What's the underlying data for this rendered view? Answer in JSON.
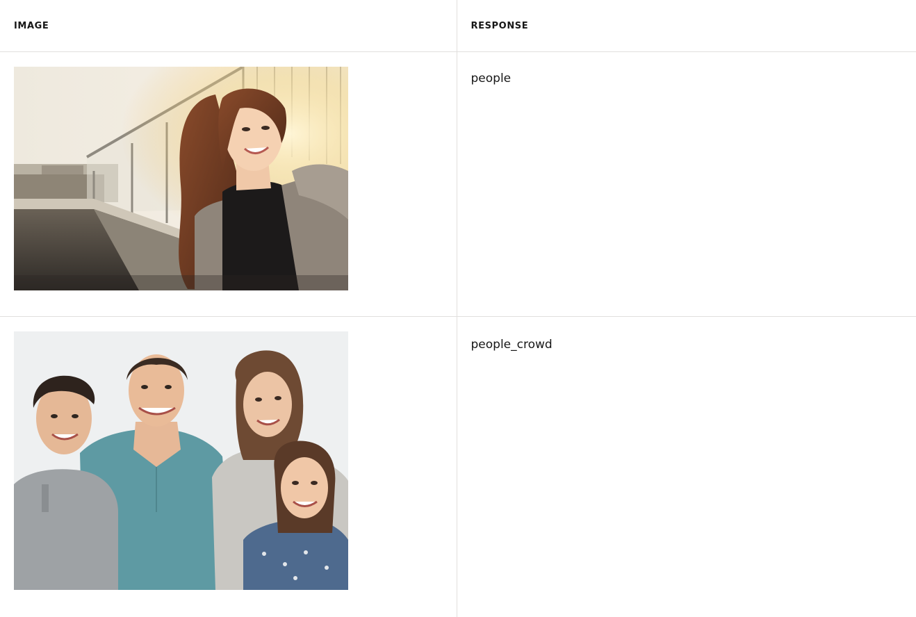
{
  "table": {
    "headers": {
      "image": "IMAGE",
      "response": "RESPONSE"
    },
    "rows": [
      {
        "image": {
          "icon": "photo-woman-on-rooftop-icon"
        },
        "response": "people"
      },
      {
        "image": {
          "icon": "photo-family-group-icon"
        },
        "response": "people_crowd"
      }
    ]
  },
  "colors": {
    "border": "#e1dfdd",
    "text": "#171717"
  }
}
